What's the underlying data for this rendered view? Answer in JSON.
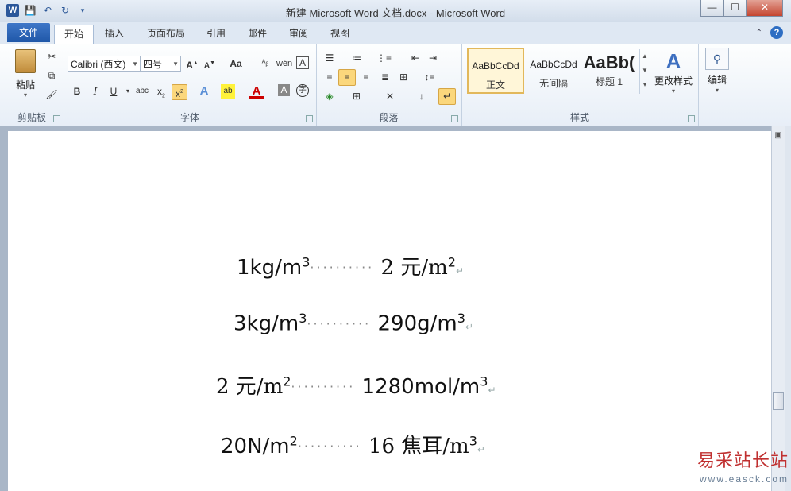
{
  "window": {
    "title": "新建 Microsoft Word 文档.docx - Microsoft Word",
    "app_icon": "W",
    "buttons": {
      "minimize": "—",
      "maximize": "☐",
      "close": "✕"
    }
  },
  "tabs": {
    "file": "文件",
    "items": [
      "开始",
      "插入",
      "页面布局",
      "引用",
      "邮件",
      "审阅",
      "视图"
    ],
    "active": "开始"
  },
  "ribbon": {
    "clipboard": {
      "label": "剪贴板",
      "paste": "粘贴"
    },
    "font": {
      "label": "字体",
      "family": "Calibri (西文)",
      "size": "四号",
      "aa": "Aa"
    },
    "paragraph": {
      "label": "段落"
    },
    "styles": {
      "label": "样式",
      "items": [
        {
          "sample": "AaBbCcDd",
          "name": "正文"
        },
        {
          "sample": "AaBbCcDd",
          "name": "无间隔"
        },
        {
          "sample": "AaBb(",
          "name": "标题 1"
        }
      ],
      "change": "更改样式"
    },
    "editing": {
      "label": "编辑"
    }
  },
  "document": {
    "lines": [
      {
        "left": "1kg/m",
        "left_sup": "3",
        "right": "2 元/m",
        "right_sup": "2"
      },
      {
        "left": "3kg/m",
        "left_sup": "3",
        "right": "290g/m",
        "right_sup": "3"
      },
      {
        "left": "2 元/m",
        "left_sup": "2",
        "right": "1280mol/m",
        "right_sup": "3"
      },
      {
        "left": "20N/m",
        "left_sup": "2",
        "right": "16 焦耳/m",
        "right_sup": "3"
      }
    ],
    "dots": "··········",
    "pilcrow": "↵"
  },
  "watermark": {
    "cn": "易采站长站",
    "url": "www.easck.com"
  }
}
